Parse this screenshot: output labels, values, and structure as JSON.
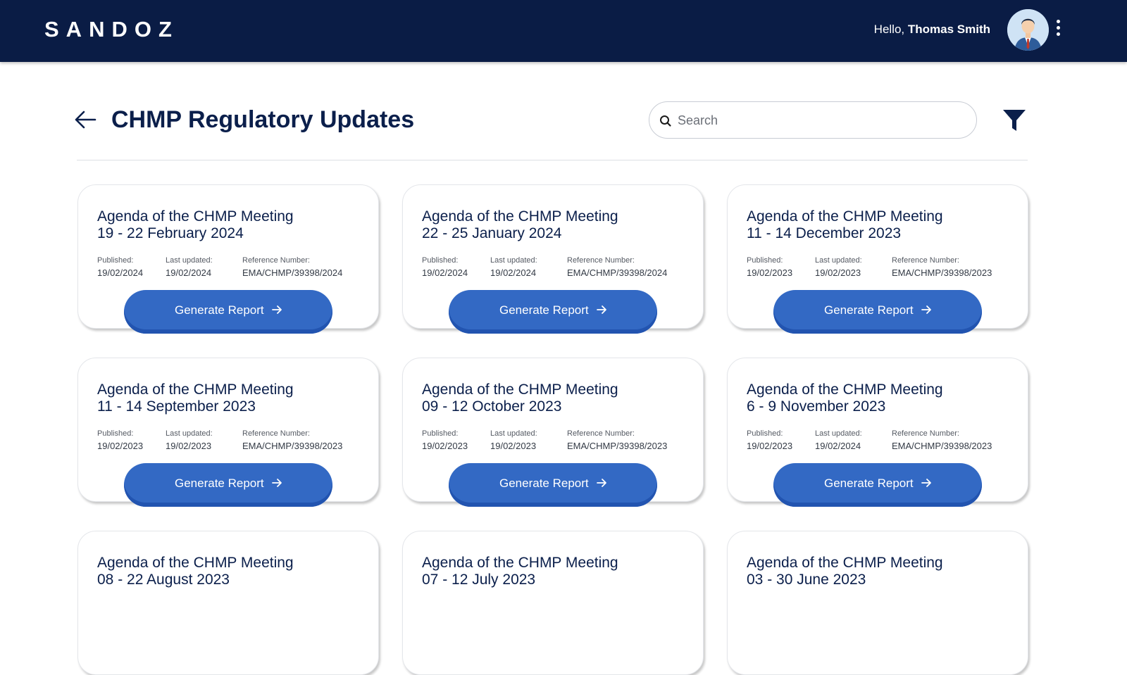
{
  "header": {
    "logo": "SANDOZ",
    "greeting_prefix": "Hello,",
    "user_name": "Thomas Smith"
  },
  "page": {
    "title": "CHMP Regulatory Updates",
    "search_placeholder": "Search"
  },
  "labels": {
    "published": "Published:",
    "last_updated": "Last updated:",
    "reference": "Reference Number:",
    "button": "Generate Report"
  },
  "cards": [
    {
      "title1": "Agenda of the CHMP Meeting",
      "title2": "19 - 22 February 2024",
      "published": "19/02/2024",
      "updated": "19/02/2024",
      "ref": "EMA/CHMP/39398/2024"
    },
    {
      "title1": "Agenda of the CHMP Meeting",
      "title2": "22 - 25 January 2024",
      "published": "19/02/2024",
      "updated": "19/02/2024",
      "ref": "EMA/CHMP/39398/2024"
    },
    {
      "title1": "Agenda of the CHMP Meeting",
      "title2": "11 - 14 December 2023",
      "published": "19/02/2023",
      "updated": "19/02/2023",
      "ref": "EMA/CHMP/39398/2023"
    },
    {
      "title1": "Agenda of the CHMP Meeting",
      "title2": "11 - 14 September 2023",
      "published": "19/02/2023",
      "updated": "19/02/2023",
      "ref": "EMA/CHMP/39398/2023"
    },
    {
      "title1": "Agenda of the CHMP Meeting",
      "title2": "09 - 12 October 2023",
      "published": "19/02/2023",
      "updated": "19/02/2023",
      "ref": "EMA/CHMP/39398/2023"
    },
    {
      "title1": "Agenda of the CHMP Meeting",
      "title2": "6 - 9 November 2023",
      "published": "19/02/2023",
      "updated": "19/02/2024",
      "ref": "EMA/CHMP/39398/2023"
    },
    {
      "title1": "Agenda of the CHMP Meeting",
      "title2": "08 - 22 August 2023"
    },
    {
      "title1": "Agenda of the CHMP Meeting",
      "title2": "07 - 12 July 2023"
    },
    {
      "title1": "Agenda of the CHMP Meeting",
      "title2": "03 - 30 June 2023"
    }
  ],
  "colors": {
    "header_bg": "#0a1c45",
    "title_text": "#0b1f4b",
    "button_bg": "#3369c4"
  },
  "icons": [
    "back-arrow-icon",
    "search-icon",
    "filter-icon",
    "arrow-right-icon",
    "kebab-menu-icon",
    "avatar"
  ]
}
